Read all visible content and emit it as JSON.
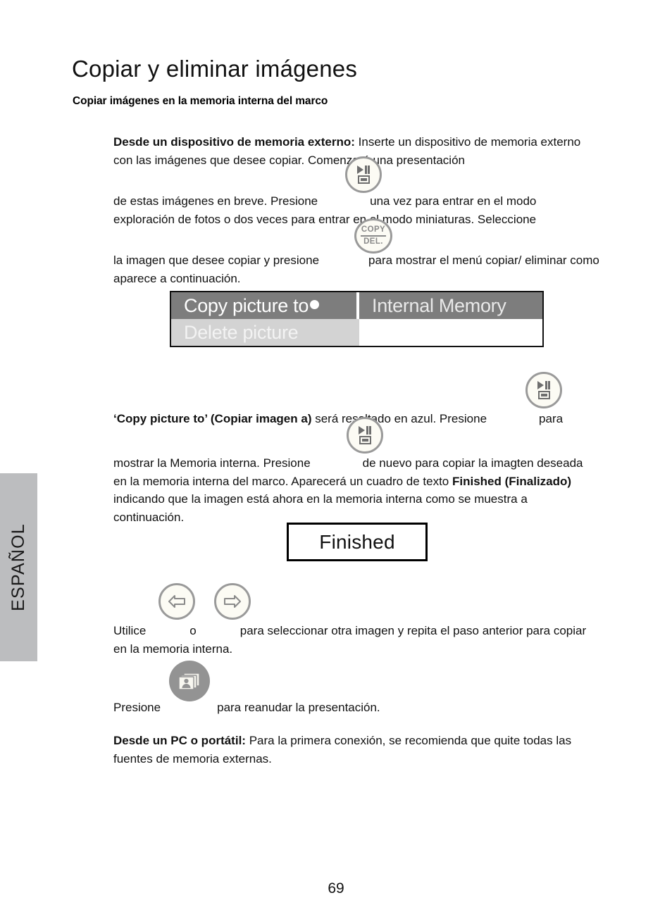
{
  "sidebar": {
    "language_tab_label": "ESPAÑOL"
  },
  "page": {
    "title": "Copiar y eliminar imágenes",
    "subtitle": "Copiar imágenes en la memoria interna del marco",
    "page_number": "69"
  },
  "paragraphs": {
    "p1_lead": "Desde un dispositivo de memoria externo:",
    "p1_rest": " Inserte un dispositivo de memoria externo con las imágenes que desee copiar. Comenzará una presentación",
    "p2_before": "de estas imágenes en breve. Presione",
    "p2_after": "una vez para entrar en el modo exploración de fotos o dos veces para entrar en el modo miniaturas. Seleccione",
    "p3_before": "la imagen que desee copiar y presione",
    "p3_after": "para mostrar el menú copiar/ eliminar como aparece a continuación.",
    "p4_lead": "‘Copy picture to’ (Copiar imagen a)",
    "p4_mid": " será resaltado en azul. Presione",
    "p4_after": "para",
    "p5_before": "mostrar la Memoria interna.  Presione",
    "p5_mid": "de nuevo para copiar la imagten deseada en la memoria interna del marco. Aparecerá un cuadro de texto ",
    "p5_bold": "Finished (Finalizado)",
    "p5_after": " indicando que la imagen está ahora en la memoria interna como se muestra a continuación.",
    "p6_before": "Utilice",
    "p6_or": "o",
    "p6_after": "para seleccionar otra imagen y repita el paso anterior para copiar en la memoria interna.",
    "p7_before": "Presione",
    "p7_after": "para reanudar la presentación.",
    "p8_lead": "Desde un PC o portátil:",
    "p8_rest": " Para la primera conexión, se   recomienda que quite todas las fuentes de memoria externas."
  },
  "buttons": {
    "play_icon_name": "play-pause-slideshow-button",
    "copydel_top": "COPY",
    "copydel_bottom": "DEL.",
    "left_arrow_name": "left-arrow-button",
    "right_arrow_name": "right-arrow-button",
    "slideshow_name": "slideshow-photos-button"
  },
  "osd_menu": {
    "row1_left": "Copy picture to",
    "row1_right": "Internal Memory",
    "row2_left": "Delete picture",
    "row2_right": "",
    "selected_dot": true,
    "colors": {
      "row1_bg": "#7d7d7d",
      "row2_bg": "#d3d3d3",
      "row1_text": "#ffffff",
      "row2_text": "#f3f3f3",
      "border": "#111111"
    }
  },
  "finished_dialog": {
    "label": "Finished"
  },
  "colors": {
    "tab_gray": "#bcbdbf",
    "button_ring": "#9a9a9a",
    "button_fill": "#fcfbf4",
    "glyph_gray": "#6e6e6e",
    "filled_button": "#939393"
  }
}
